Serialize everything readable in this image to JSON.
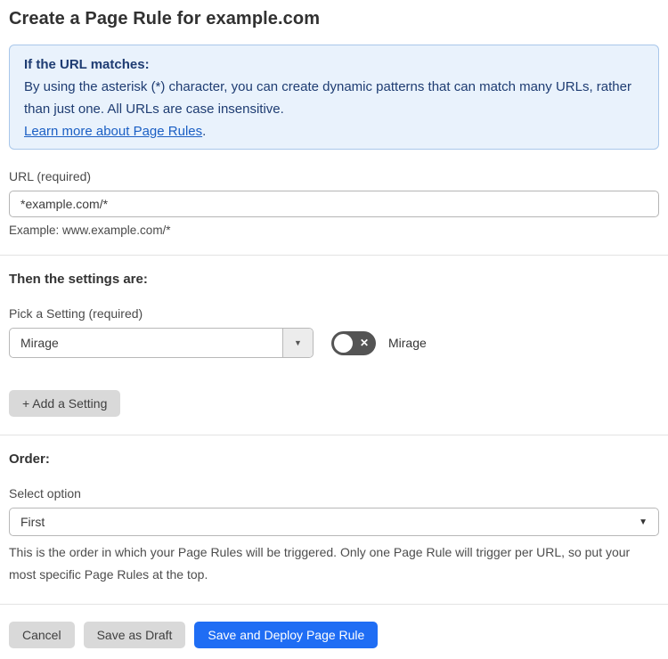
{
  "page": {
    "title": "Create a Page Rule for example.com"
  },
  "info_box": {
    "heading": "If the URL matches:",
    "body": "By using the asterisk (*) character, you can create dynamic patterns that can match many URLs, rather than just one. All URLs are case insensitive.",
    "link_label": "Learn more about Page Rules",
    "link_suffix": "."
  },
  "url_field": {
    "label": "URL (required)",
    "value": "*example.com/*",
    "helper": "Example: www.example.com/*"
  },
  "settings_section": {
    "heading": "Then the settings are:",
    "setting_label": "Pick a Setting (required)",
    "setting_value": "Mirage",
    "dropdown_arrow": "▼",
    "toggle_state": "off",
    "toggle_x": "✕",
    "toggle_label": "Mirage",
    "add_button_label": "+ Add a Setting"
  },
  "order_section": {
    "heading": "Order:",
    "label": "Select option",
    "value": "First",
    "dropdown_arrow": "▼",
    "helper": "This is the order in which your Page Rules will be triggered. Only one Page Rule will trigger per URL, so put your most specific Page Rules at the top."
  },
  "footer": {
    "cancel_label": "Cancel",
    "save_draft_label": "Save as Draft",
    "save_deploy_label": "Save and Deploy Page Rule"
  },
  "colors": {
    "info_bg": "#e9f2fc",
    "info_border": "#a9c7ea",
    "info_text": "#1e3c72",
    "link": "#1b5fc4",
    "primary_button": "#1f6df4",
    "gray_button": "#d9d9d9",
    "toggle_off": "#545454"
  }
}
